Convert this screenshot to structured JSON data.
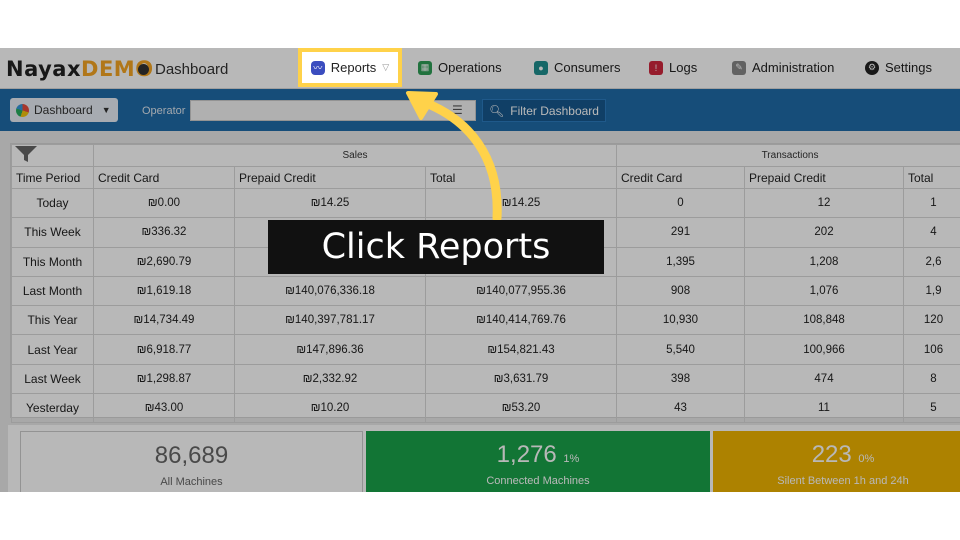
{
  "brand": {
    "name": "Nayax",
    "suffix": "DEMO"
  },
  "breadcrumb": "Dashboard",
  "nav": [
    {
      "label": "Reports",
      "icon": "chart-icon",
      "color": "#3b4dbf"
    },
    {
      "label": "Operations",
      "icon": "operations-icon",
      "color": "#2e9e57"
    },
    {
      "label": "Consumers",
      "icon": "consumers-icon",
      "color": "#1f8f8f"
    },
    {
      "label": "Logs",
      "icon": "logs-icon",
      "color": "#d0273d"
    },
    {
      "label": "Administration",
      "icon": "administration-icon",
      "color": "#777777"
    },
    {
      "label": "Settings",
      "icon": "settings-icon",
      "color": "#222222"
    }
  ],
  "toolbar": {
    "dashboard_label": "Dashboard",
    "operator_label": "Operator",
    "operator_value": "",
    "filter_label": "Filter Dashboard"
  },
  "table": {
    "groups": {
      "sales": "Sales",
      "transactions": "Transactions"
    },
    "columns": [
      "Time Period",
      "Credit Card",
      "Prepaid Credit",
      "Total",
      "Credit Card",
      "Prepaid Credit",
      "Total"
    ],
    "rows": [
      [
        "Today",
        "₪0.00",
        "₪14.25",
        "₪14.25",
        "0",
        "12",
        "1"
      ],
      [
        "This Week",
        "₪336.32",
        "",
        "",
        "291",
        "202",
        "4"
      ],
      [
        "This Month",
        "₪2,690.79",
        "",
        "",
        "1,395",
        "1,208",
        "2,6"
      ],
      [
        "Last Month",
        "₪1,619.18",
        "₪140,076,336.18",
        "₪140,077,955.36",
        "908",
        "1,076",
        "1,9"
      ],
      [
        "This Year",
        "₪14,734.49",
        "₪140,397,781.17",
        "₪140,414,769.76",
        "10,930",
        "108,848",
        "120"
      ],
      [
        "Last Year",
        "₪6,918.77",
        "₪147,896.36",
        "₪154,821.43",
        "5,540",
        "100,966",
        "106"
      ],
      [
        "Last Week",
        "₪1,298.87",
        "₪2,332.92",
        "₪3,631.79",
        "398",
        "474",
        "8"
      ],
      [
        "Yesterday",
        "₪43.00",
        "₪10.20",
        "₪53.20",
        "43",
        "11",
        "5"
      ]
    ]
  },
  "cards": [
    {
      "value": "86,689",
      "pct": "",
      "label": "All Machines",
      "bg": "#ffffff",
      "fg": "#666666"
    },
    {
      "value": "1,276",
      "pct": "1%",
      "label": "Connected Machines",
      "bg": "#1aa34a",
      "fg": "#ffffff"
    },
    {
      "value": "223",
      "pct": "0%",
      "label": "Silent Between 1h and 24h",
      "bg": "#f0b400",
      "fg": "#ffffff"
    }
  ],
  "highlight": {
    "label": "Reports"
  },
  "caption": "Click Reports",
  "colors": {
    "toolbar": "#1f6ba8",
    "highlight": "#ffd24a",
    "brand_accent": "#f5a623"
  }
}
